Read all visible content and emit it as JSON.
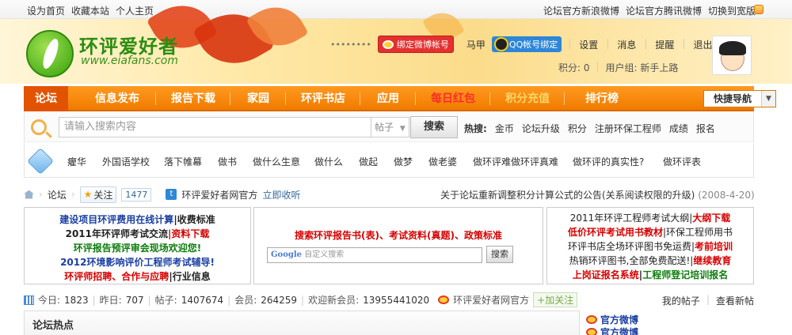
{
  "topbar": {
    "left": [
      "设为首页",
      "收藏本站",
      "个人主页"
    ],
    "right": [
      "论坛官方新浪微博",
      "论坛官方腾讯微博",
      "切换到宽版"
    ]
  },
  "logo": {
    "title": "环评爱好者",
    "url": "www.eiafans.com"
  },
  "user": {
    "name": "••••••••",
    "weibo_bind": "绑定微博帐号",
    "mood": "马甲",
    "qq_bind": "QQ帐号绑定",
    "links": [
      "设置",
      "消息",
      "提醒",
      "退出"
    ],
    "score": "积分: 0",
    "group": "用户组: 新手上路"
  },
  "nav": {
    "items": [
      "论坛",
      "信息发布",
      "报告下载",
      "家园",
      "环评书店",
      "应用",
      "每日红包",
      "积分充值",
      "排行榜"
    ],
    "quick": "快捷导航"
  },
  "search": {
    "placeholder": "请输入搜索内容",
    "type": "帖子",
    "button": "搜索",
    "hot_label": "热搜:",
    "hot": [
      "金币",
      "论坛升级",
      "积分",
      "注册环保工程师",
      "成绩",
      "报名"
    ]
  },
  "tags": [
    "癯华",
    "外国语学校",
    "落下帷幕",
    "做书",
    "做什么生意",
    "做什么",
    "做起",
    "做梦",
    "做老婆",
    "做环评难做环评真难",
    "做环评的真实性?",
    "做环评表"
  ],
  "breadcrumb": {
    "forum": "论坛",
    "fav": "关注",
    "fav_count": "1477",
    "site": "环评爱好者网官方",
    "listen": "立即收听",
    "notice": "关于论坛重新调整积分计算公式的公告(关系阅读权限的升级)",
    "notice_date": "(2008-4-20)"
  },
  "ads": {
    "left": {
      "l1a": "建设项目环评费用在线计算",
      "l1b": "|收费标准",
      "l2a": "2011年环评师考试交流",
      "l2b": "|资料下载",
      "l3": "环评报告预评审会现场欢迎您!",
      "l4": "2012环境影响评价工程师考试辅导!",
      "l5a": "环评师招聘、合作与应聘",
      "l5b": "|行业信息"
    },
    "mid": {
      "headline": "搜索环评报告书(表)、考试资料(真题)、政策标准",
      "google": "Google",
      "search_placeholder": "自定义搜索",
      "search_btn": "搜索"
    },
    "right": {
      "l1a": "2011年环评工程师考试大纲|",
      "l1b": "大纲下载",
      "l2a": "低价环评考试用书教材",
      "l2b": "|环保工程师用书",
      "l3a": "环评书店全场环评图书免运费|",
      "l3b": "考前培训",
      "l4a": "热销环评图书,全部免费配送!|",
      "l4b": "继续教育",
      "l5a": "上岗证报名系统",
      "l5b": "|",
      "l5c": "工程师登记培训报名"
    }
  },
  "stats": {
    "today_label": "今日:",
    "today": "1823",
    "yesterday_label": "昨日:",
    "yesterday": "707",
    "posts_label": "帖子:",
    "posts": "1407674",
    "members_label": "会员:",
    "members": "264259",
    "welcome_label": "欢迎新会员:",
    "welcome": "13955441020",
    "site": "环评爱好者网官方",
    "follow": "+加关注",
    "my_posts": "我的帖子",
    "new_posts": "查看新帖"
  },
  "hot_section": {
    "title": "论坛热点"
  },
  "side": [
    "官方微博",
    "官方微博"
  ]
}
